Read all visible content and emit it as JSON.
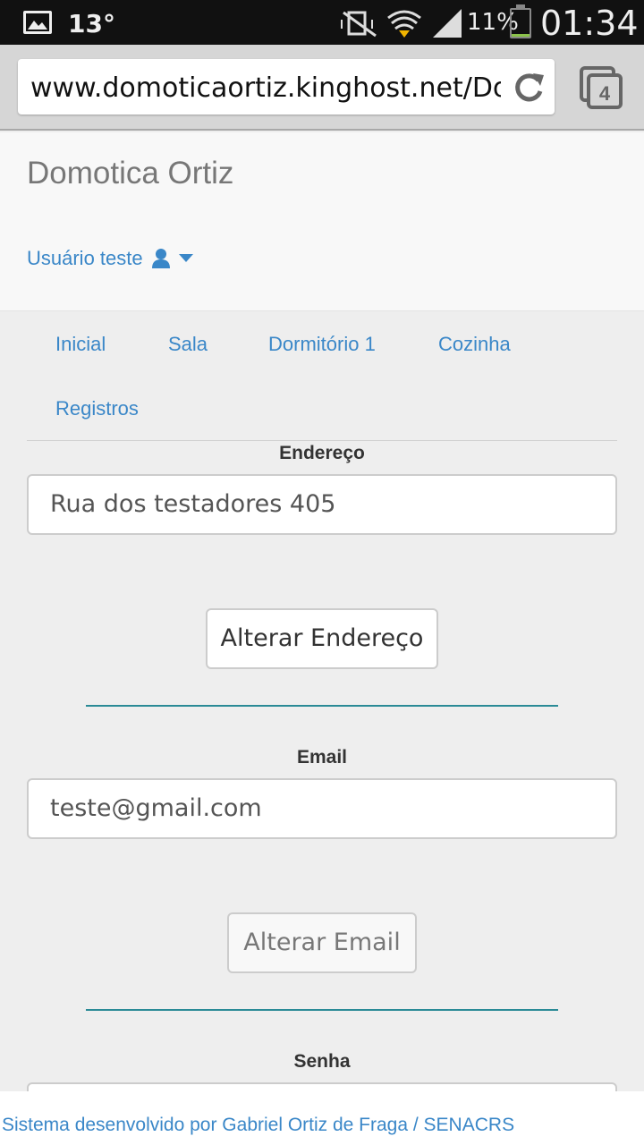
{
  "status_bar": {
    "temperature": "13°",
    "battery_percent": "11%",
    "battery_level": 0.11,
    "time": "01:34",
    "icons": [
      "gallery-icon",
      "mute-vibrate-icon",
      "wifi-icon",
      "signal-icon",
      "battery-icon"
    ]
  },
  "browser": {
    "url": "www.domoticaortiz.kinghost.net/Domotica",
    "tab_count": "4"
  },
  "header": {
    "brand": "Domotica Ortiz",
    "user_label": "Usuário teste"
  },
  "nav": {
    "items": [
      {
        "label": "Inicial"
      },
      {
        "label": "Sala"
      },
      {
        "label": "Dormitório 1"
      },
      {
        "label": "Cozinha"
      },
      {
        "label": "Registros"
      }
    ]
  },
  "form": {
    "address_label": "Endereço",
    "address_value": "Rua dos testadores 405",
    "change_address_button": "Alterar Endereço",
    "email_label": "Email",
    "email_value": "teste@gmail.com",
    "change_email_button": "Alterar Email",
    "password_label": "Senha"
  },
  "footer": {
    "text": "Sistema desenvolvido por Gabriel Ortiz de Fraga / SENACRS"
  },
  "colors": {
    "link": "#3a87c8",
    "rule": "#2a8a96"
  }
}
